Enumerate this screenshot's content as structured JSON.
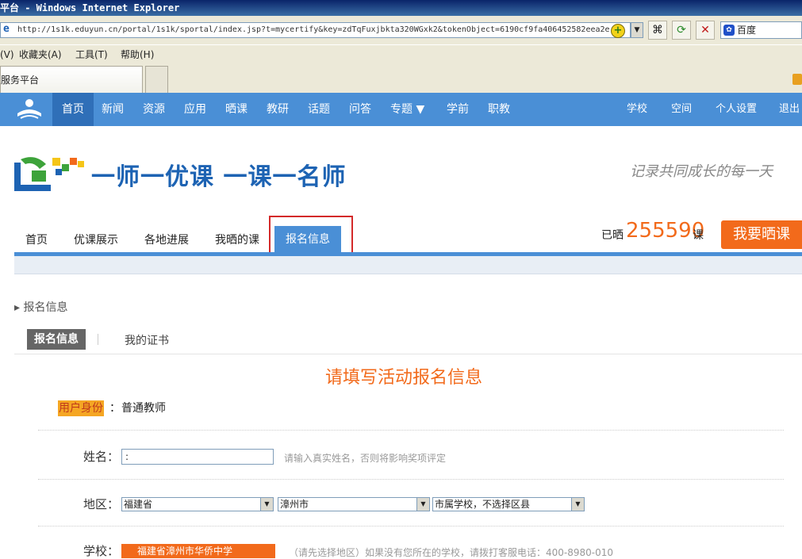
{
  "browser": {
    "window_title": "平台 - Windows Internet Explorer",
    "url": "http://1s1k.eduyun.cn/portal/1s1k/sportal/index.jsp?t=mycertify&key=zdTqFuxjbkta320WGxk2&tokenObject=6190cf9fa406452582eea2e",
    "search_engine": "百度",
    "menu": [
      "(V)",
      "收藏夹(A)",
      "工具(T)",
      "帮助(H)"
    ],
    "tab_title": "服务平台"
  },
  "site_nav": {
    "items": [
      "首页",
      "新闻",
      "资源",
      "应用",
      "晒课",
      "教研",
      "话题",
      "问答",
      "专题 ▼",
      "学前",
      "职教"
    ],
    "active_index": 0,
    "right_items": [
      "学校",
      "空间",
      "个人设置",
      "退出"
    ]
  },
  "header": {
    "brand": "一师一优课 一课一名师",
    "slogan": "记录共同成长的每一天",
    "subnav": [
      "首页",
      "优课展示",
      "各地进展",
      "我晒的课",
      "报名信息"
    ],
    "subnav_active": "报名信息",
    "counter_prefix": "已晒",
    "counter_value": "255590",
    "counter_suffix": "课",
    "cta": "我要晒课"
  },
  "content": {
    "breadcrumb": "▸ 报名信息",
    "tabs": [
      "报名信息",
      "我的证书"
    ],
    "form_title": "请填写活动报名信息",
    "role_label": "用户身份",
    "role_sep": "：",
    "role_value": "普通教师",
    "name_label": "姓名：",
    "name_value": ":",
    "name_hint": "请输入真实姓名，否则将影响奖项评定",
    "region_label": "地区：",
    "province": "福建省",
    "city": "漳州市",
    "district": "市属学校，不选择区县",
    "school_label": "学校：",
    "school_value": "福建省漳州市华侨中学",
    "school_hint": "（请先选择地区）如果没有您所在的学校，请拨打客服电话：400-8980-010"
  },
  "colors": {
    "primary": "#4a8fd6",
    "accent": "#f26a1b",
    "highlight": "#d42a2a"
  }
}
